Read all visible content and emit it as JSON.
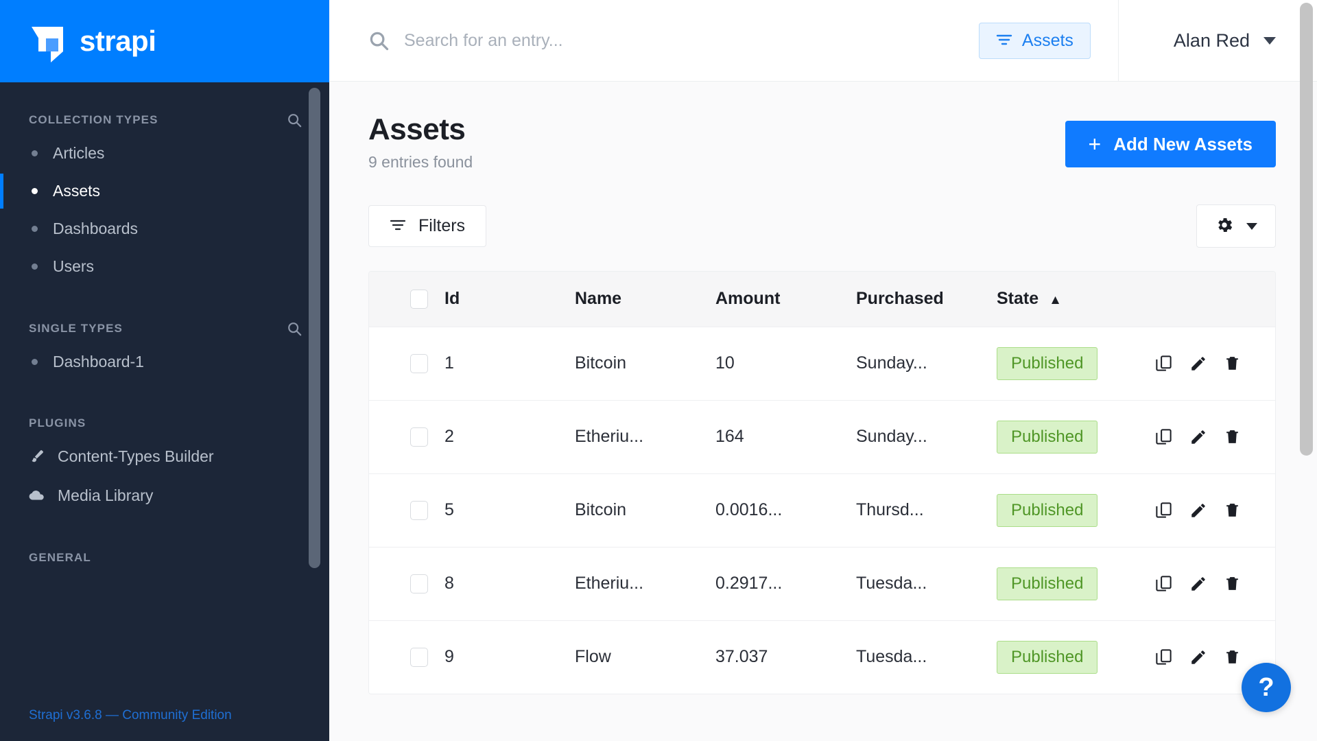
{
  "brand": {
    "name": "strapi"
  },
  "sidebar": {
    "sections": [
      {
        "title": "COLLECTION TYPES",
        "search_icon": "search-icon",
        "items": [
          {
            "label": "Articles",
            "active": false
          },
          {
            "label": "Assets",
            "active": true
          },
          {
            "label": "Dashboards",
            "active": false
          },
          {
            "label": "Users",
            "active": false
          }
        ]
      },
      {
        "title": "SINGLE TYPES",
        "search_icon": "search-icon",
        "items": [
          {
            "label": "Dashboard-1",
            "active": false
          }
        ]
      }
    ],
    "plugins": {
      "title": "PLUGINS",
      "items": [
        {
          "label": "Content-Types Builder",
          "icon": "brush-icon"
        },
        {
          "label": "Media Library",
          "icon": "cloud-icon"
        }
      ]
    },
    "general": {
      "title": "GENERAL"
    },
    "version": "Strapi v3.6.8 — Community Edition"
  },
  "topbar": {
    "search": {
      "placeholder": "Search for an entry...",
      "value": "",
      "icon": "search-icon"
    },
    "assets_pill": {
      "label": "Assets",
      "icon": "filter-icon"
    },
    "user": {
      "name": "Alan Red",
      "icon": "chevron-down-icon"
    }
  },
  "page": {
    "title": "Assets",
    "subtitle": "9 entries found",
    "add_button": {
      "label": "Add New Assets",
      "icon": "plus-icon"
    },
    "filters_button": {
      "label": "Filters",
      "icon": "filter-icon"
    },
    "settings_button": {
      "icon": "gear-icon",
      "caret": "chevron-down-icon"
    }
  },
  "table": {
    "columns": [
      "Id",
      "Name",
      "Amount",
      "Purchased",
      "State"
    ],
    "sort": {
      "column": "State",
      "direction": "asc",
      "indicator": "▲"
    },
    "rows": [
      {
        "id": "1",
        "name": "Bitcoin",
        "amount": "10",
        "purchased": "Sunday...",
        "state": "Published"
      },
      {
        "id": "2",
        "name": "Etheriu...",
        "amount": "164",
        "purchased": "Sunday...",
        "state": "Published"
      },
      {
        "id": "5",
        "name": "Bitcoin",
        "amount": "0.0016...",
        "purchased": "Thursd...",
        "state": "Published"
      },
      {
        "id": "8",
        "name": "Etheriu...",
        "amount": "0.2917...",
        "purchased": "Tuesda...",
        "state": "Published"
      },
      {
        "id": "9",
        "name": "Flow",
        "amount": "37.037",
        "purchased": "Tuesda...",
        "state": "Published"
      }
    ],
    "row_actions": [
      "duplicate-icon",
      "edit-icon",
      "delete-icon"
    ]
  },
  "help": {
    "label": "?"
  },
  "colors": {
    "brand_blue": "#007eff",
    "sidebar_bg": "#1c2638",
    "primary_button": "#107bff",
    "badge_bg": "#d9f2c8",
    "badge_text": "#4f9626",
    "version_link": "#1f6fd4"
  }
}
